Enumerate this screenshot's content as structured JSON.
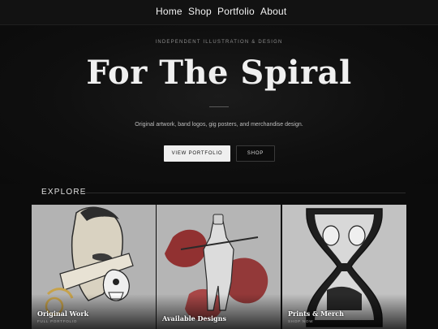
{
  "nav": {
    "items": [
      {
        "label": "Home"
      },
      {
        "label": "Shop"
      },
      {
        "label": "Portfolio"
      },
      {
        "label": "About"
      }
    ]
  },
  "hero": {
    "kicker": "INDEPENDENT ILLUSTRATION & DESIGN",
    "title": "For The Spiral",
    "tagline": "Original artwork, band logos, gig posters, and merchandise design.",
    "primary_button": "VIEW PORTFOLIO",
    "secondary_button": "SHOP"
  },
  "explore": {
    "label": "EXPLORE",
    "cards": [
      {
        "title": "Original Work",
        "subtitle": "FULL PORTFOLIO",
        "image": "illustration-skull-face"
      },
      {
        "title": "Available Designs",
        "subtitle": "",
        "image": "illustration-knight-red"
      },
      {
        "title": "Prints & Merch",
        "subtitle": "SHOP NOW",
        "image": "illustration-hourglass"
      }
    ]
  },
  "colors": {
    "background": "#0c0c0c",
    "nav_background": "#121212",
    "text": "#f0f0f0",
    "accent_red": "#8b1a1a"
  }
}
